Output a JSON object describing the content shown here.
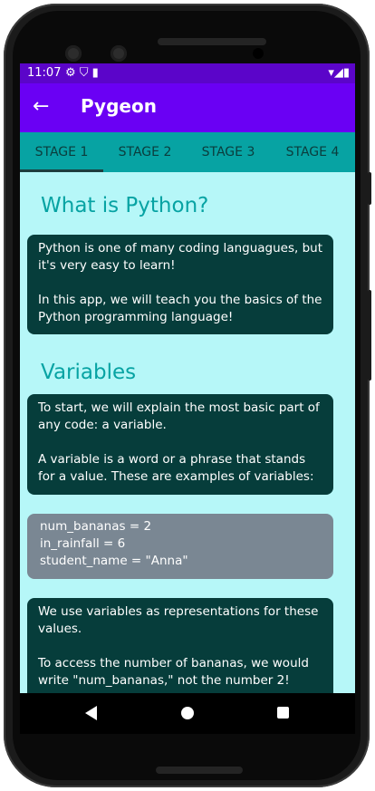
{
  "status": {
    "time": "11:07",
    "left_icons": "⚙ ⛉ ▮",
    "right_icons": "▾◢▮"
  },
  "appbar": {
    "back_glyph": "←",
    "title": "Pygeon"
  },
  "tabs": [
    "STAGE 1",
    "STAGE 2",
    "STAGE 3",
    "STAGE 4"
  ],
  "sections": {
    "what": {
      "heading": "What is Python?",
      "p1": "Python is one of many coding languagues, but it's very easy to learn!",
      "p2": "In this app, we will teach you the basics of the Python programming language!"
    },
    "variables": {
      "heading": "Variables",
      "p1": "To start, we will explain the most basic part of any code: a variable.",
      "p2": "A variable is a word or a phrase that stands for a value. These are examples of variables:"
    },
    "code": [
      "num_bananas = 2",
      "in_rainfall = 6",
      "student_name = \"Anna\""
    ],
    "usage": {
      "p1": "We use variables as representations for these values.",
      "p2": "To access the number of bananas, we would write \"num_bananas,\" not the number 2!"
    }
  },
  "colors": {
    "primary_dark": "#5b05c9",
    "primary": "#6a00f4",
    "tab_bar": "#07a3a3",
    "background": "#b6f7f8",
    "card": "#063d3b",
    "code_card": "#7a8793"
  },
  "icons": {
    "status_left": [
      "settings-icon",
      "shield-icon",
      "sim-card-icon"
    ],
    "status_right": [
      "wifi-icon",
      "signal-icon",
      "battery-icon"
    ],
    "nav": [
      "back-triangle-icon",
      "home-circle-icon",
      "recents-square-icon"
    ]
  }
}
